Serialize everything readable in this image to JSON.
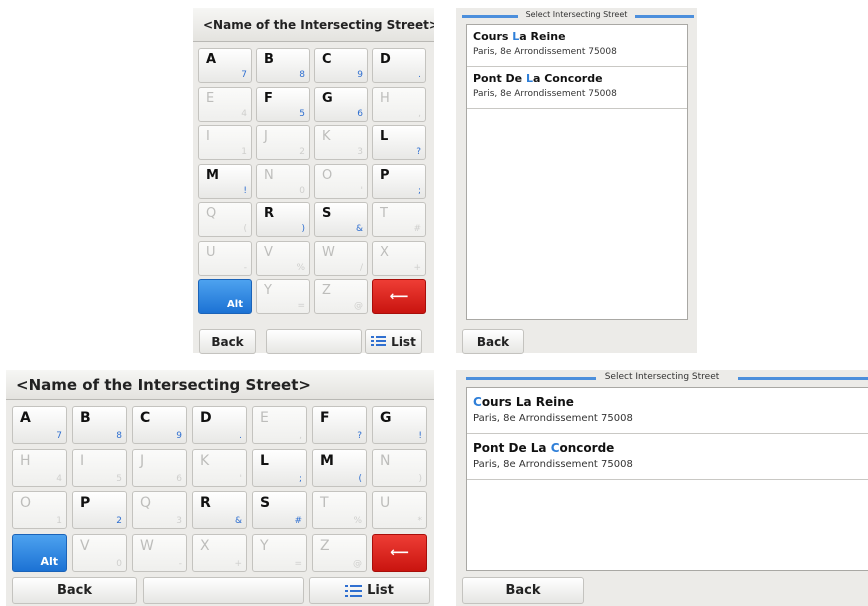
{
  "keyboard": {
    "header": "<Name of the Intersecting Street>",
    "alt_label": "Alt",
    "backspace_glyph": "⟵",
    "back_label": "Back",
    "list_label": "List"
  },
  "select": {
    "title": "Select Intersecting Street",
    "back_label": "Back",
    "items": [
      {
        "pre": "Cours ",
        "hl": "L",
        "post": "a Reine",
        "address": "Paris, 8e Arrondissement 75008"
      },
      {
        "pre": "Pont De ",
        "hl": "L",
        "post": "a Concorde",
        "address": "Paris, 8e Arrondissement 75008"
      }
    ],
    "items_alt": [
      {
        "pre": "",
        "hl": "C",
        "post": "ours La Reine",
        "address": "Paris, 8e Arrondissement 75008"
      },
      {
        "pre": "Pont De La ",
        "hl": "C",
        "post": "oncorde",
        "address": "Paris, 8e Arrondissement 75008"
      }
    ]
  },
  "small_keys": [
    [
      {
        "m": "A",
        "s": "7",
        "on": true
      },
      {
        "m": "B",
        "s": "8",
        "on": true
      },
      {
        "m": "C",
        "s": "9",
        "on": true
      },
      {
        "m": "D",
        "s": ".",
        "on": true
      }
    ],
    [
      {
        "m": "E",
        "s": "4",
        "on": false
      },
      {
        "m": "F",
        "s": "5",
        "on": true
      },
      {
        "m": "G",
        "s": "6",
        "on": true
      },
      {
        "m": "H",
        "s": ",",
        "on": false
      }
    ],
    [
      {
        "m": "I",
        "s": "1",
        "on": false
      },
      {
        "m": "J",
        "s": "2",
        "on": false
      },
      {
        "m": "K",
        "s": "3",
        "on": false
      },
      {
        "m": "L",
        "s": "?",
        "on": true
      }
    ],
    [
      {
        "m": "M",
        "s": "!",
        "on": true
      },
      {
        "m": "N",
        "s": "0",
        "on": false
      },
      {
        "m": "O",
        "s": "'",
        "on": false
      },
      {
        "m": "P",
        "s": ";",
        "on": true
      }
    ],
    [
      {
        "m": "Q",
        "s": "(",
        "on": false
      },
      {
        "m": "R",
        "s": ")",
        "on": true
      },
      {
        "m": "S",
        "s": "&",
        "on": true
      },
      {
        "m": "T",
        "s": "#",
        "on": false
      }
    ],
    [
      {
        "m": "U",
        "s": "-",
        "on": false
      },
      {
        "m": "V",
        "s": "%",
        "on": false
      },
      {
        "m": "W",
        "s": "/",
        "on": false
      },
      {
        "m": "X",
        "s": "+",
        "on": false
      }
    ],
    [
      {
        "m": "Alt",
        "s": "",
        "kind": "alt"
      },
      {
        "m": "Y",
        "s": "=",
        "on": false
      },
      {
        "m": "Z",
        "s": "@",
        "on": false
      },
      {
        "m": "",
        "s": "",
        "kind": "del"
      }
    ]
  ],
  "big_keys": [
    [
      {
        "m": "A",
        "s": "7",
        "on": true
      },
      {
        "m": "B",
        "s": "8",
        "on": true
      },
      {
        "m": "C",
        "s": "9",
        "on": true
      },
      {
        "m": "D",
        "s": ".",
        "on": true
      },
      {
        "m": "E",
        "s": ",",
        "on": false
      },
      {
        "m": "F",
        "s": "?",
        "on": true
      },
      {
        "m": "G",
        "s": "!",
        "on": true
      }
    ],
    [
      {
        "m": "H",
        "s": "4",
        "on": false
      },
      {
        "m": "I",
        "s": "5",
        "on": false
      },
      {
        "m": "J",
        "s": "6",
        "on": false
      },
      {
        "m": "K",
        "s": "'",
        "on": false
      },
      {
        "m": "L",
        "s": ";",
        "on": true
      },
      {
        "m": "M",
        "s": "(",
        "on": true
      },
      {
        "m": "N",
        "s": ")",
        "on": false
      }
    ],
    [
      {
        "m": "O",
        "s": "1",
        "on": false
      },
      {
        "m": "P",
        "s": "2",
        "on": true
      },
      {
        "m": "Q",
        "s": "3",
        "on": false
      },
      {
        "m": "R",
        "s": "&",
        "on": true
      },
      {
        "m": "S",
        "s": "#",
        "on": true
      },
      {
        "m": "T",
        "s": "%",
        "on": false
      },
      {
        "m": "U",
        "s": "*",
        "on": false
      }
    ],
    [
      {
        "m": "Alt",
        "s": "",
        "kind": "alt"
      },
      {
        "m": "V",
        "s": "0",
        "on": false
      },
      {
        "m": "W",
        "s": "-",
        "on": false
      },
      {
        "m": "X",
        "s": "+",
        "on": false
      },
      {
        "m": "Y",
        "s": "=",
        "on": false
      },
      {
        "m": "Z",
        "s": "@",
        "on": false
      },
      {
        "m": "",
        "s": "",
        "kind": "del"
      }
    ]
  ],
  "colors": {
    "accent": "#2f6fd0",
    "alt_key": "#1c72d4",
    "delete_key": "#c9140f"
  }
}
